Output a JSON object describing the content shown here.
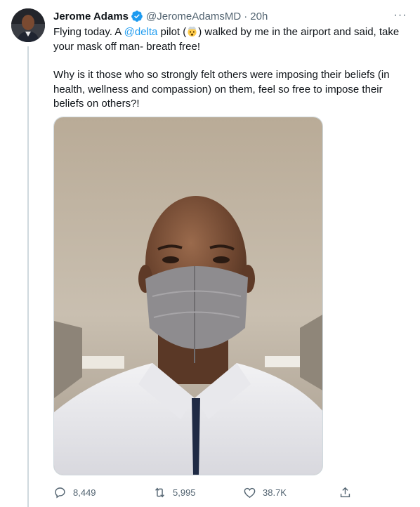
{
  "tweet": {
    "author_name": "Jerome Adams",
    "author_handle": "@JeromeAdamsMD",
    "separator": "·",
    "timestamp": "20h",
    "more_label": "···",
    "text": {
      "p1_a": "Flying today. A ",
      "p1_mention": "@delta",
      "p1_b": " pilot (",
      "p1_c": ") walked by me in the airport and said, take your mask off man- breath free!",
      "p2": "Why is it those who so strongly felt others were imposing their beliefs (in health, wellness and compassion) on them, feel so free to impose their beliefs on others?!"
    },
    "icons": {
      "verified": "verified-badge-icon",
      "emoji": "exploding-head-emoji"
    },
    "media": {
      "description_icon": "selfie-photo"
    },
    "actions": {
      "replies": "8,449",
      "retweets": "5,995",
      "likes": "38.7K"
    }
  },
  "colors": {
    "accent": "#1d9bf0",
    "text": "#0f1419",
    "muted": "#536471",
    "divider": "#cfd9de"
  }
}
